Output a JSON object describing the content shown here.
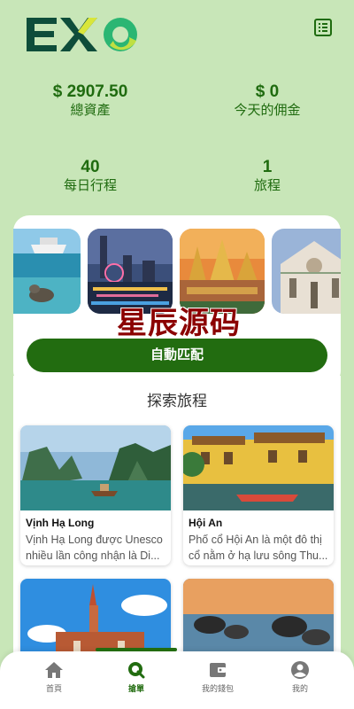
{
  "app": {
    "logo_text": "EXO",
    "colors": {
      "primary": "#226c10",
      "background": "#c8e6b8",
      "text_green": "#1f6b0f"
    }
  },
  "header": {
    "menu_icon": "list-icon",
    "stats": [
      {
        "value": "$ 2907.50",
        "label": "總資產"
      },
      {
        "value": "$ 0",
        "label": "今天的佣金"
      },
      {
        "value": "40",
        "label": "每日行程"
      },
      {
        "value": "1",
        "label": "旅程"
      }
    ]
  },
  "carousel": {
    "slides": [
      "sea-lion-boat",
      "city-ferris-wheel",
      "thai-temple",
      "florence-church"
    ]
  },
  "watermark": "星辰源码",
  "auto_match_label": "自動匹配",
  "explore": {
    "title": "探索旅程",
    "tours": [
      {
        "name": "Vịnh Hạ Long",
        "desc_line1": "Vịnh Hạ Long được Unesco",
        "desc_line2": "nhiều lần công nhận là Di..."
      },
      {
        "name": "Hội An",
        "desc_line1": "Phố cổ Hội An là một đô thị",
        "desc_line2": "cổ nằm ở hạ lưu sông Thu..."
      },
      {
        "name": "",
        "desc_line1": "",
        "desc_line2": ""
      },
      {
        "name": "",
        "desc_line1": "",
        "desc_line2": ""
      }
    ]
  },
  "tabbar": {
    "active_index": 1,
    "tabs": [
      {
        "label": "首頁",
        "icon": "home-icon"
      },
      {
        "label": "搶單",
        "icon": "search-grab-icon"
      },
      {
        "label": "我的錢包",
        "icon": "wallet-icon"
      },
      {
        "label": "我的",
        "icon": "user-icon"
      }
    ]
  }
}
